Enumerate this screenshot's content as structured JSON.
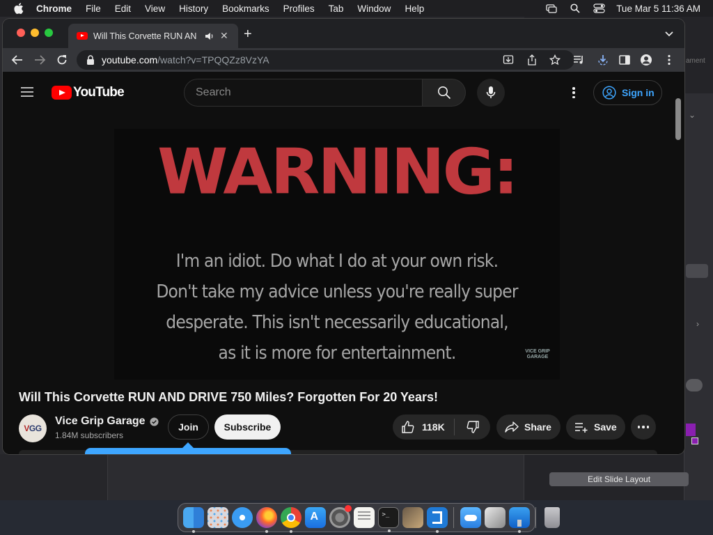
{
  "menubar": {
    "app_name": "Chrome",
    "menus": [
      "File",
      "Edit",
      "View",
      "History",
      "Bookmarks",
      "Profiles",
      "Tab",
      "Window",
      "Help"
    ],
    "clock": "Tue Mar 5  11:36 AM"
  },
  "background_app": {
    "edit_slide_layout_label": "Edit Slide Layout",
    "ghost_text": "ament"
  },
  "browser": {
    "tab_title": "Will This Corvette RUN AN",
    "url_host": "youtube.com",
    "url_path": "/watch?v=TPQQZz8VzYA"
  },
  "youtube": {
    "logo_text": "YouTube",
    "search_placeholder": "Search",
    "sign_in_label": "Sign in",
    "video": {
      "warning_heading": "WARNING:",
      "warning_lines": [
        "I'm an idiot. Do what I do at your own risk.",
        "Don't take my advice unless you're really super",
        "desperate.  This isn't necessarily educational,",
        "as it is more for entertainment."
      ],
      "watermark_top": "VICE GRIP",
      "watermark_bottom": "GARAGE"
    },
    "title": "Will This Corvette RUN AND DRIVE 750 Miles? Forgotten For 20 Years!",
    "channel": {
      "avatar_text_a": "V",
      "avatar_text_b": "GG",
      "name": "Vice Grip Garage",
      "subscribers": "1.84M subscribers"
    },
    "actions": {
      "join_label": "Join",
      "subscribe_label": "Subscribe",
      "like_count": "118K",
      "share_label": "Share",
      "save_label": "Save"
    }
  },
  "dock": {
    "apps": [
      "finder-icon",
      "launchpad-icon",
      "safari-icon",
      "firefox-icon",
      "chrome-icon",
      "app-store-icon",
      "system-settings-icon",
      "textedit-icon",
      "terminal-icon",
      "instruments-icon",
      "vscode-icon",
      "icloud-icon",
      "preview-icon",
      "keynote-icon",
      "trash-icon"
    ]
  },
  "colors": {
    "youtube_red": "#ff0000",
    "link_blue": "#3ea6ff",
    "warning_red": "#c0393e",
    "page_bg": "#0f0f0f"
  }
}
